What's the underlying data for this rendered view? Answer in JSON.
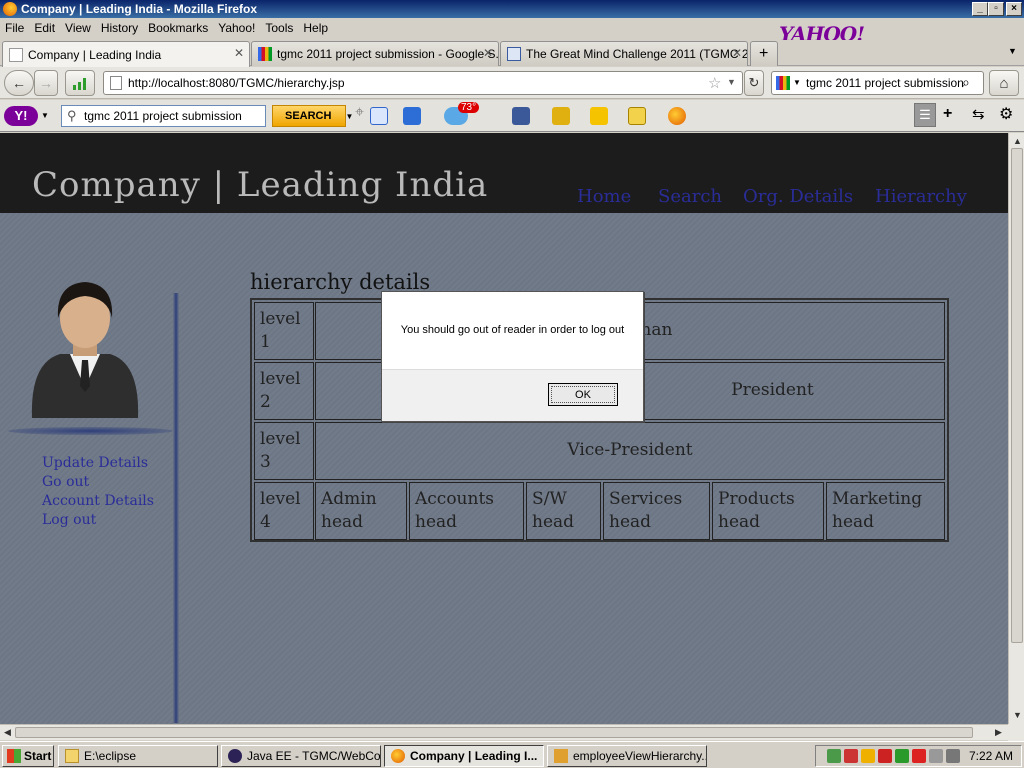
{
  "window": {
    "title": "Company | Leading India - Mozilla Firefox"
  },
  "menu": [
    "File",
    "Edit",
    "View",
    "History",
    "Bookmarks",
    "Yahoo!",
    "Tools",
    "Help"
  ],
  "yahoo_logo": "YAHOO!",
  "tabs": [
    {
      "label": "Company | Leading India",
      "active": true
    },
    {
      "label": "tgmc 2011 project submission - Google S..."
    },
    {
      "label": "The Great Mind Challenge 2011 (TGMC 2..."
    }
  ],
  "nav": {
    "url": "http://localhost:8080/TGMC/hierarchy.jsp",
    "search_value": "tgmc 2011 project submission"
  },
  "yahoo_toolbar": {
    "search_value": "tgmc 2011 project submission",
    "search_button": "SEARCH",
    "weather": "73°"
  },
  "site": {
    "title": "Company | Leading India",
    "nav": [
      "Home",
      "Search",
      "Org. Details",
      "Hierarchy"
    ],
    "sidebar_links": [
      "Update Details",
      "Go out",
      "Account Details",
      "Log out"
    ],
    "section_title": "hierarchy details",
    "hierarchy": {
      "level1": {
        "label": "level 1",
        "value": "Chairman"
      },
      "level2": {
        "label": "level 2",
        "value": "President"
      },
      "level3": {
        "label": "level 3",
        "value": "Vice-President"
      },
      "level4": {
        "label": "level 4",
        "values": [
          "Admin head",
          "Accounts head",
          "S/W head",
          "Services head",
          "Products head",
          "Marketing head"
        ]
      }
    }
  },
  "dialog": {
    "message": "You should go out of reader in order to log out",
    "ok_label": "OK"
  },
  "taskbar": {
    "start": "Start",
    "tasks": [
      "E:\\eclipse",
      "Java EE - TGMC/WebCo...",
      "Company | Leading I...",
      "employeeViewHierarchy...."
    ],
    "clock": "7:22 AM"
  }
}
